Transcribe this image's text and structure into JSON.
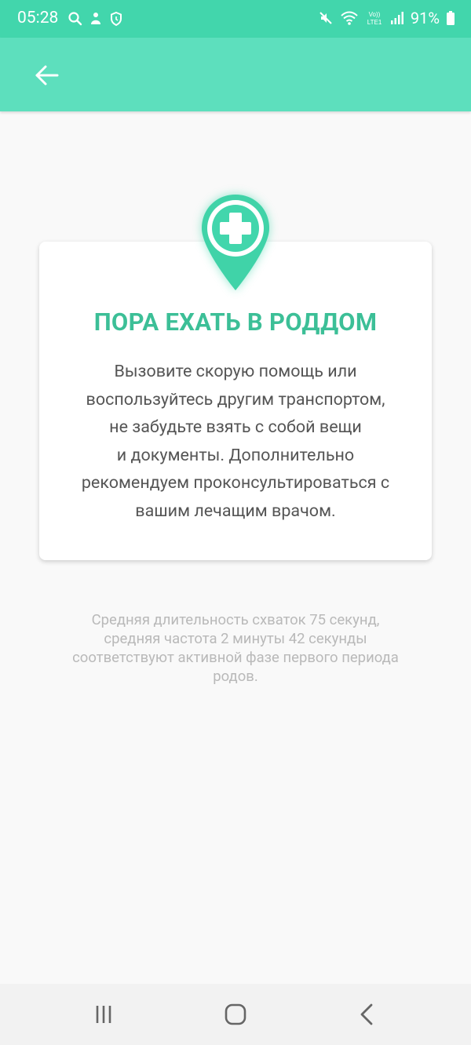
{
  "status_bar": {
    "time": "05:28",
    "battery": "91%",
    "icons": [
      "search-icon",
      "notification-icon",
      "shield-icon",
      "mute-icon",
      "wifi-icon",
      "volte-icon",
      "signal-icon",
      "battery-icon"
    ]
  },
  "app_bar": {
    "back_icon": "arrow-left-icon"
  },
  "card": {
    "icon": "hospital-location-icon",
    "title": "ПОРА ЕХАТЬ В РОДДОМ",
    "text_lines": [
      "Вызовите скорую помощь или",
      "воспользуйтесь другим транспортом,",
      "не забудьте взять с собой вещи",
      "и документы. Дополнительно",
      "рекомендуем проконсультироваться с",
      "вашим лечащим врачом."
    ]
  },
  "info": {
    "lines": [
      "Средняя длительность схваток 75 секунд,",
      "средняя частота 2 минуты 42 секунды",
      "соответствуют активной фазе первого периода",
      "родов."
    ]
  },
  "colors": {
    "status_bar": "#42d6ac",
    "app_bar": "#5ddfbd",
    "accent": "#3cbf97"
  },
  "nav_bar": {
    "icons": [
      "recent-apps-icon",
      "home-icon",
      "back-icon"
    ]
  }
}
